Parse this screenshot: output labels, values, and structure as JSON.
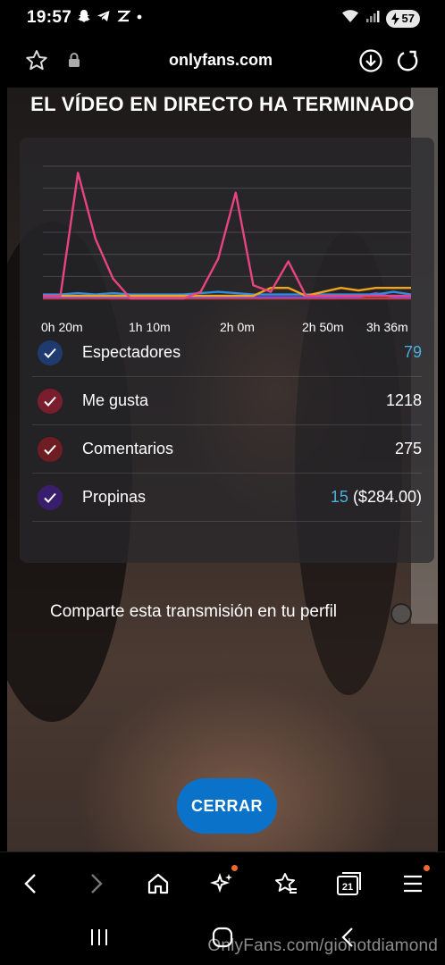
{
  "status_bar": {
    "time": "19:57",
    "battery": "57"
  },
  "browser": {
    "url": "onlyfans.com"
  },
  "live_end": {
    "title": "EL VÍDEO EN DIRECTO HA TERMINADO",
    "chart_data": {
      "type": "line",
      "x_tick_labels": [
        "0h 20m",
        "1h 10m",
        "2h 0m",
        "2h 50m",
        "3h 36m"
      ],
      "x": [
        0,
        1,
        2,
        3,
        4,
        5,
        6,
        7,
        8,
        9,
        10,
        11,
        12,
        13,
        14,
        15,
        16,
        17,
        18,
        19,
        20,
        21
      ],
      "series": [
        {
          "color": "#e8447f",
          "values": [
            2,
            2,
            95,
            45,
            15,
            0,
            0,
            0,
            0,
            5,
            30,
            80,
            10,
            5,
            28,
            2,
            2,
            2,
            2,
            2,
            2,
            2
          ]
        },
        {
          "color": "#f0a61c",
          "values": [
            2,
            2,
            2,
            2,
            2,
            2,
            2,
            2,
            2,
            2,
            2,
            2,
            2,
            8,
            8,
            2,
            5,
            8,
            6,
            8,
            8,
            8
          ]
        },
        {
          "color": "#2f8ce0",
          "values": [
            3,
            3,
            4,
            3,
            4,
            3,
            3,
            3,
            3,
            4,
            5,
            4,
            3,
            3,
            3,
            3,
            3,
            3,
            3,
            3,
            5,
            3
          ]
        },
        {
          "color": "#8a46d8",
          "values": [
            1,
            1,
            1,
            1,
            1,
            1,
            1,
            1,
            1,
            1,
            1,
            1,
            1,
            1,
            1,
            1,
            1,
            1,
            1,
            4,
            1,
            1
          ]
        },
        {
          "color": "#c43c3c",
          "values": [
            0,
            0,
            0,
            0,
            0,
            0,
            0,
            0,
            0,
            0,
            0,
            0,
            0,
            0,
            0,
            0,
            0,
            0,
            0,
            0,
            0,
            0
          ]
        }
      ],
      "ylim": [
        0,
        100
      ]
    },
    "metrics": [
      {
        "label": "Espectadores",
        "value": "79",
        "value_suffix": "",
        "badge_color": "#1e3a6e",
        "accent": true
      },
      {
        "label": "Me gusta",
        "value": "1218",
        "value_suffix": "",
        "badge_color": "#7a1e2e",
        "accent": false
      },
      {
        "label": "Comentarios",
        "value": "275",
        "value_suffix": "",
        "badge_color": "#6e1e22",
        "accent": false
      },
      {
        "label": "Propinas",
        "value": "15",
        "value_suffix": " ($284.00)",
        "badge_color": "#3a1e6e",
        "accent": true
      }
    ],
    "share_label": "Comparte esta transmisión en tu perfil",
    "close_label": "CERRAR"
  },
  "toolbar": {
    "tabs_count": "21"
  },
  "watermark": "OnlyFans.com/giohotdiamond"
}
